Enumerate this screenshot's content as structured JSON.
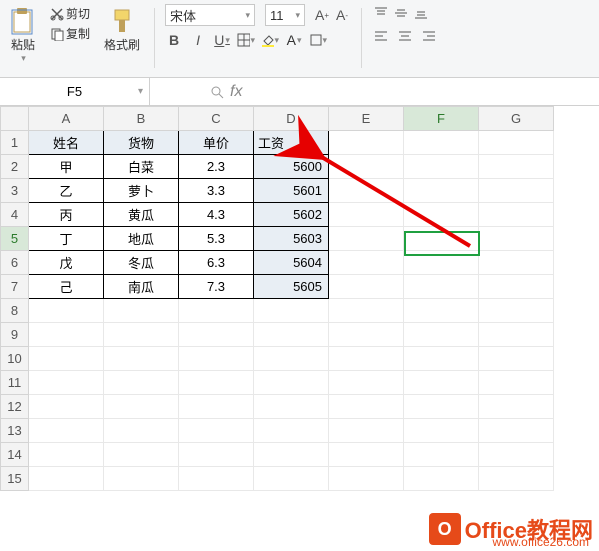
{
  "ribbon": {
    "paste_label": "粘贴",
    "cut_label": "剪切",
    "copy_label": "复制",
    "format_painter_label": "格式刷",
    "font_name": "宋体",
    "font_size": "11"
  },
  "namebox": "F5",
  "fx_label": "fx",
  "columns": [
    "A",
    "B",
    "C",
    "D",
    "E",
    "F",
    "G"
  ],
  "rows": [
    "1",
    "2",
    "3",
    "4",
    "5",
    "6",
    "7",
    "8",
    "9",
    "10",
    "11",
    "12",
    "13",
    "14",
    "15"
  ],
  "headers": {
    "c0": "姓名",
    "c1": "货物",
    "c2": "单价",
    "c3": "工资"
  },
  "data": [
    {
      "name": "甲",
      "goods": "白菜",
      "price": "2.3",
      "wage": "5600"
    },
    {
      "name": "乙",
      "goods": "萝卜",
      "price": "3.3",
      "wage": "5601"
    },
    {
      "name": "丙",
      "goods": "黄瓜",
      "price": "4.3",
      "wage": "5602"
    },
    {
      "name": "丁",
      "goods": "地瓜",
      "price": "5.3",
      "wage": "5603"
    },
    {
      "name": "戊",
      "goods": "冬瓜",
      "price": "6.3",
      "wage": "5604"
    },
    {
      "name": "己",
      "goods": "南瓜",
      "price": "7.3",
      "wage": "5605"
    }
  ],
  "chart_data": {
    "type": "table",
    "title": "",
    "columns": [
      "姓名",
      "货物",
      "单价",
      "工资"
    ],
    "rows": [
      [
        "甲",
        "白菜",
        2.3,
        5600
      ],
      [
        "乙",
        "萝卜",
        3.3,
        5601
      ],
      [
        "丙",
        "黄瓜",
        4.3,
        5602
      ],
      [
        "丁",
        "地瓜",
        5.3,
        5603
      ],
      [
        "戊",
        "冬瓜",
        6.3,
        5604
      ],
      [
        "己",
        "南瓜",
        7.3,
        5605
      ]
    ]
  },
  "watermark": {
    "brand": "Office教程网",
    "url": "www.office26.com",
    "logo": "O"
  }
}
